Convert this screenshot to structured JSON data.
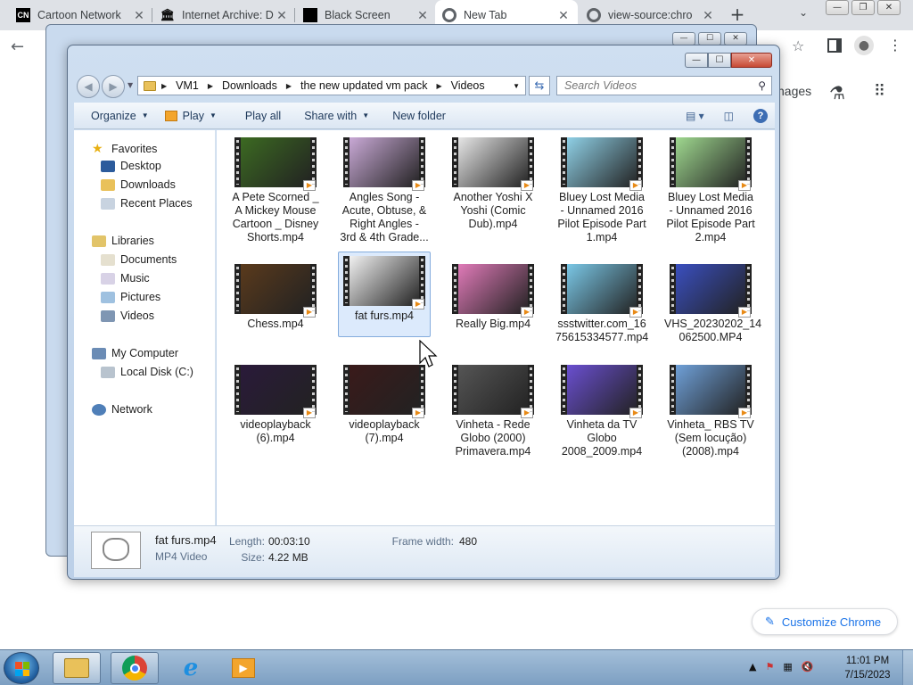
{
  "chrome": {
    "tabs": [
      {
        "title": "Cartoon Network",
        "favicon": "CN"
      },
      {
        "title": "Internet Archive: D",
        "favicon": "archive-icon"
      },
      {
        "title": "Black Screen",
        "favicon": "black-square-icon"
      },
      {
        "title": "New Tab",
        "favicon": "chrome-icon",
        "active": true
      },
      {
        "title": "view-source:chro",
        "favicon": "chrome-icon"
      }
    ],
    "ntp_images_label": "nages",
    "customize_label": "Customize Chrome"
  },
  "explorer": {
    "breadcrumb": [
      "VM1",
      "Downloads",
      "the new updated vm pack",
      "Videos"
    ],
    "search_placeholder": "Search Videos",
    "toolbar": {
      "organize": "Organize",
      "play": "Play",
      "play_all": "Play all",
      "share_with": "Share with",
      "new_folder": "New folder"
    },
    "nav": {
      "favorites": "Favorites",
      "desktop": "Desktop",
      "downloads": "Downloads",
      "recent_places": "Recent Places",
      "libraries": "Libraries",
      "documents": "Documents",
      "music": "Music",
      "pictures": "Pictures",
      "videos": "Videos",
      "my_computer": "My Computer",
      "local_disk": "Local Disk (C:)",
      "network": "Network"
    },
    "files": [
      {
        "name": "A Pete Scorned _ A Mickey Mouse Cartoon _ Disney Shorts.mp4",
        "label": "A Pete Scorned _\nA Mickey Mouse\nCartoon _ Disney\nShorts.mp4",
        "thumb": "#3c6a22"
      },
      {
        "name": "Angles Song - Acute, Obtuse, & Right Angles - 3rd & 4th Grade...",
        "label": "Angles Song -\nAcute, Obtuse, &\nRight Angles -\n3rd & 4th Grade...",
        "thumb": "#c9a9d6"
      },
      {
        "name": "Another Yoshi X Yoshi (Comic Dub).mp4",
        "label": "Another Yoshi X\nYoshi (Comic\nDub).mp4",
        "thumb": "#e6e6e6"
      },
      {
        "name": "Bluey Lost Media - Unnamed 2016 Pilot Episode Part 1.mp4",
        "label": "Bluey Lost Media\n- Unnamed 2016\nPilot Episode Part\n1.mp4",
        "thumb": "#8fd0e6"
      },
      {
        "name": "Bluey Lost Media - Unnamed 2016 Pilot Episode Part 2.mp4",
        "label": "Bluey Lost Media\n- Unnamed 2016\nPilot Episode Part\n2.mp4",
        "thumb": "#9fd88f"
      },
      {
        "name": "Chess.mp4",
        "label": "Chess.mp4",
        "thumb": "#5a3a1c"
      },
      {
        "name": "fat furs.mp4",
        "label": "fat furs.mp4",
        "thumb": "#f2f2f2",
        "selected": true
      },
      {
        "name": "Really Big.mp4",
        "label": "Really Big.mp4",
        "thumb": "#e07ab8"
      },
      {
        "name": "ssstwitter.com_1675615334577.mp4",
        "label": "ssstwitter.com_16\n75615334577.mp4",
        "thumb": "#7ac7e6"
      },
      {
        "name": "VHS_20230202_14062500.MP4",
        "label": "VHS_20230202_14\n062500.MP4",
        "thumb": "#3a4fbf"
      },
      {
        "name": "videoplayback (6).mp4",
        "label": "videoplayback\n(6).mp4",
        "thumb": "#2a1a3a"
      },
      {
        "name": "videoplayback (7).mp4",
        "label": "videoplayback\n(7).mp4",
        "thumb": "#3a1a1a"
      },
      {
        "name": "Vinheta - Rede Globo (2000) Primavera.mp4",
        "label": "Vinheta - Rede\nGlobo (2000)\nPrimavera.mp4",
        "thumb": "#555555"
      },
      {
        "name": "Vinheta da TV Globo 2008_2009.mp4",
        "label": "Vinheta da TV\nGlobo\n2008_2009.mp4",
        "thumb": "#6a4fd0"
      },
      {
        "name": "Vinheta_ RBS TV (Sem locução) (2008).mp4",
        "label": "Vinheta_ RBS TV\n(Sem locução)\n(2008).mp4",
        "thumb": "#6fa0d8"
      }
    ],
    "details": {
      "name": "fat furs.mp4",
      "type": "MP4 Video",
      "length_label": "Length:",
      "length": "00:03:10",
      "size_label": "Size:",
      "size": "4.22 MB",
      "frame_width_label": "Frame width:",
      "frame_width": "480"
    }
  },
  "taskbar": {
    "time": "11:01 PM",
    "date": "7/15/2023"
  }
}
